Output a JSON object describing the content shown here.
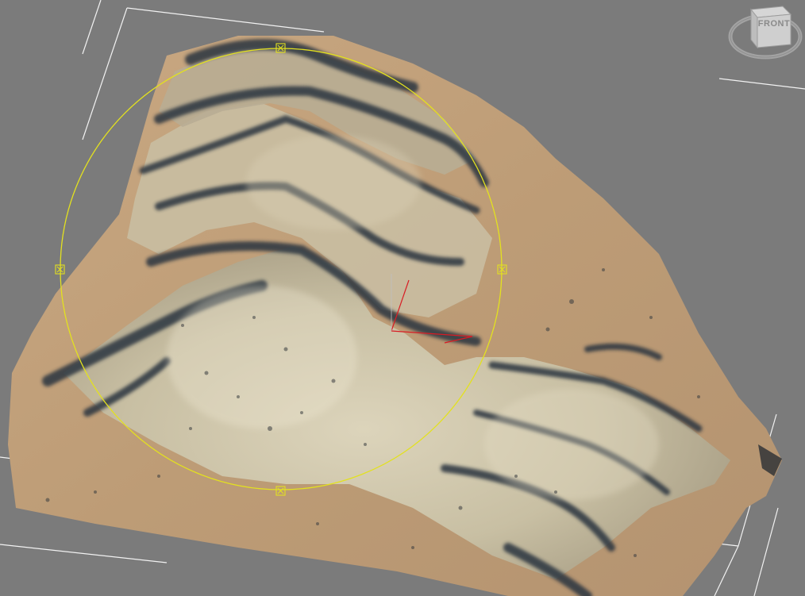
{
  "viewport": {
    "background_color": "#7b7b7b"
  },
  "viewcube": {
    "face_label": "FRONT",
    "icon": "viewcube-icon"
  },
  "terrain": {
    "icon": "terrain-mesh",
    "sand_color": "#c2a27c",
    "rock_light_color": "#cfc6aa",
    "rock_dark_color": "#2c3440"
  },
  "gizmo": {
    "circle_color": "#e3e11f",
    "axis_color": "#d81c24",
    "handle_count": 4
  },
  "bounding_box_color": "#f2f2f2"
}
